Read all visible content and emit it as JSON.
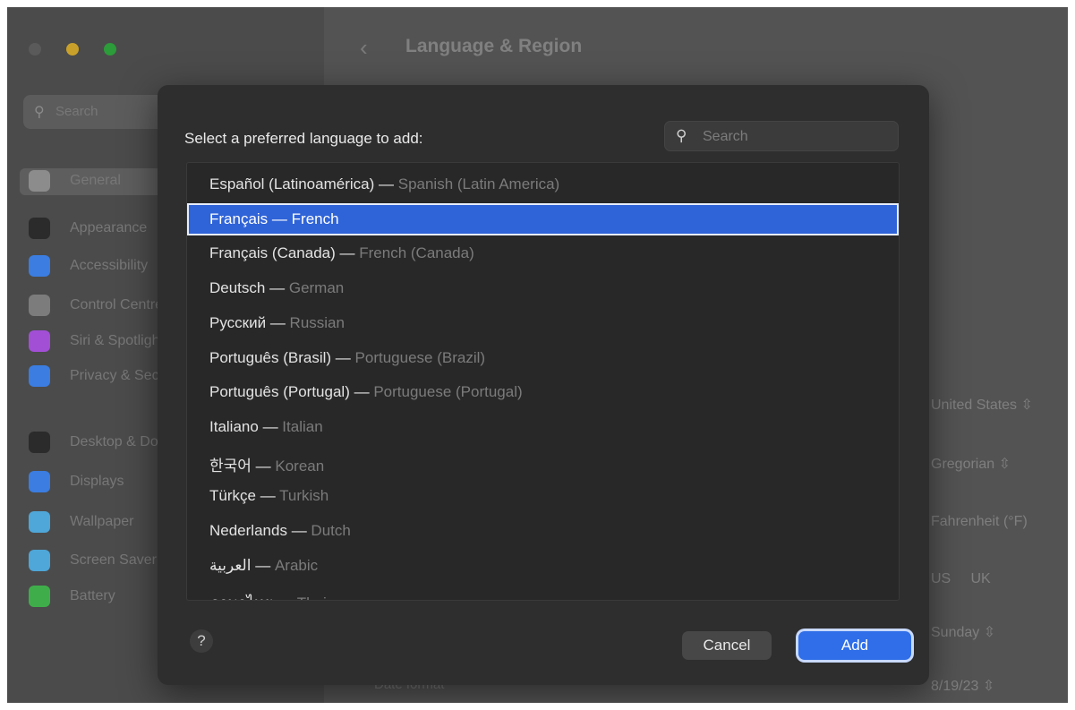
{
  "header": {
    "title": "Language & Region",
    "back_icon": "chevron-left-icon"
  },
  "sidebar": {
    "search_placeholder": "Search",
    "items": [
      {
        "label": "General",
        "icon": "gear-icon",
        "color": "#8c8c8c",
        "selected": true
      },
      {
        "label": "Appearance",
        "icon": "appearance-icon",
        "color": "#2b2b2b"
      },
      {
        "label": "Accessibility",
        "icon": "accessibility-icon",
        "color": "#3b7de0"
      },
      {
        "label": "Control Centre",
        "icon": "control-centre-icon",
        "color": "#7c7c7c"
      },
      {
        "label": "Siri & Spotlight",
        "icon": "siri-icon",
        "color": "#a24fd6"
      },
      {
        "label": "Privacy & Security",
        "icon": "hand-icon",
        "color": "#3b7de0"
      },
      {
        "label": "Desktop & Dock",
        "icon": "dock-icon",
        "color": "#2b2b2b"
      },
      {
        "label": "Displays",
        "icon": "display-icon",
        "color": "#3b7de0"
      },
      {
        "label": "Wallpaper",
        "icon": "wallpaper-icon",
        "color": "#4fa6d8"
      },
      {
        "label": "Screen Saver",
        "icon": "screen-saver-icon",
        "color": "#4fa6d8"
      },
      {
        "label": "Battery",
        "icon": "battery-icon",
        "color": "#3fae4a"
      }
    ]
  },
  "main_settings": {
    "region": "United States",
    "calendar": "Gregorian",
    "temperature": "Fahrenheit (°F)",
    "measurement_us": "US",
    "measurement_uk": "UK",
    "first_day": "Sunday",
    "date_format_label": "Date format",
    "date_format": "8/19/23"
  },
  "dialog": {
    "prompt": "Select a preferred language to add:",
    "search_placeholder": "Search",
    "languages": [
      {
        "native": "Español (Latinoamérica)",
        "english": "Spanish (Latin America)"
      },
      {
        "native": "Français",
        "english": "French",
        "selected": true
      },
      {
        "native": "Français (Canada)",
        "english": "French (Canada)"
      },
      {
        "native": "Deutsch",
        "english": "German"
      },
      {
        "native": "Русский",
        "english": "Russian"
      },
      {
        "native": "Português (Brasil)",
        "english": "Portuguese (Brazil)"
      },
      {
        "native": "Português (Portugal)",
        "english": "Portuguese (Portugal)"
      },
      {
        "native": "Italiano",
        "english": "Italian"
      },
      {
        "native": "한국어",
        "english": "Korean"
      },
      {
        "native": "Türkçe",
        "english": "Turkish"
      },
      {
        "native": "Nederlands",
        "english": "Dutch"
      },
      {
        "native": "العربية",
        "english": "Arabic"
      },
      {
        "native": "ภาษาไทย",
        "english": "Thai"
      }
    ],
    "separator": "—",
    "help_label": "?",
    "cancel_label": "Cancel",
    "add_label": "Add"
  },
  "colors": {
    "accent": "#2f6ee8",
    "selection": "#2f63d8",
    "dialog_bg": "#2e2e2e"
  }
}
